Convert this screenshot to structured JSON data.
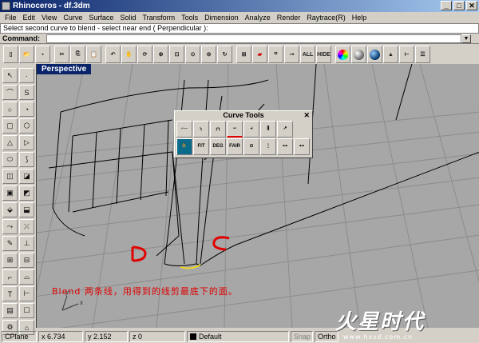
{
  "window": {
    "title": "Rhinoceros - df.3dm",
    "min": "_",
    "max": "□",
    "close": "✕"
  },
  "menu": [
    "File",
    "Edit",
    "View",
    "Curve",
    "Surface",
    "Solid",
    "Transform",
    "Tools",
    "Dimension",
    "Analyze",
    "Render",
    "Raytrace(R)",
    "Help"
  ],
  "command": {
    "history": "Select second curve to blend - select near end ( Perpendicular ):",
    "label": "Command:",
    "value": ""
  },
  "toolbar": {
    "icons": [
      "new-icon",
      "open-icon",
      "save-icon",
      "cut-icon",
      "copy-icon",
      "paste-icon",
      "undo-icon",
      "pan-icon",
      "rotate-view-icon",
      "zoom-icon",
      "zoom-window-icon",
      "zoom-extents-icon",
      "zoom-selected-icon",
      "redraw-icon",
      "layout-icon",
      "car-icon",
      "select-icon",
      "points-on-icon"
    ],
    "all_label": "ALL",
    "hide_label": "HIDE",
    "trailing_icons": [
      "color-wheel-icon",
      "shade-icon",
      "render-icon",
      "lights-icon",
      "dimension-icon",
      "properties-icon"
    ]
  },
  "palette": [
    "↖",
    "·",
    "⌒",
    "S",
    "○",
    "◔",
    "▢",
    "⬡",
    "△",
    "▷",
    "⬭",
    "⟆",
    "◫",
    "◪",
    "▣",
    "◩",
    "⬙",
    "⬓",
    "⤳",
    "⤬",
    "✎",
    "⊥",
    "⊞",
    "⊟",
    "⌐",
    "⌓",
    "T",
    "⊢",
    "▤",
    "☐",
    "⚙",
    "⌂"
  ],
  "viewport": {
    "title": "Perspective"
  },
  "curve_tools": {
    "title": "Curve Tools",
    "close": "✕",
    "row1": [
      "⌐─",
      "╮",
      "╭╮",
      "∽",
      "⫞",
      "⫼",
      "↗"
    ],
    "row2_labels": [
      "",
      "FIT",
      "DEG",
      "FAIR",
      "⊙",
      "⋮",
      "⊶",
      "⊷"
    ]
  },
  "annotation": {
    "label_d": "D",
    "label_c": "C",
    "text": "Blend 两条线，用得到的线剪最底下的面。"
  },
  "axis": {
    "x": "x",
    "y": "y"
  },
  "status": {
    "cplane": "CPlane",
    "x": "x 6.734",
    "y": "y 2.152",
    "z": "z 0",
    "layer": "Default",
    "snap": "Snap",
    "ortho": "Ortho"
  },
  "watermark": {
    "main": "火星时代",
    "url": "www.hxsd.com.cn"
  },
  "colors": {
    "titlebar": "#0a246a",
    "viewport_bg": "#a7a7a7",
    "annotation": "#e00000"
  }
}
